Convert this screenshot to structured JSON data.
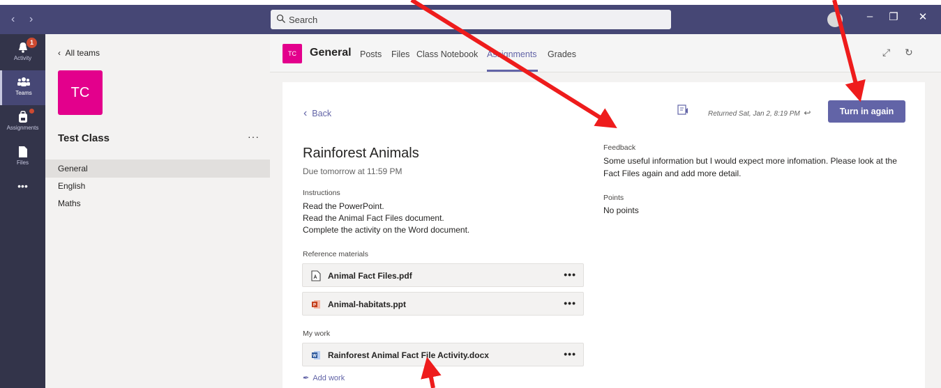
{
  "titlebar": {
    "back_icon": "chevron-left-icon",
    "forward_icon": "chevron-right-icon",
    "search_placeholder": "Search",
    "window_minimize": "–",
    "window_restore": "❐",
    "window_close": "✕"
  },
  "rail": {
    "items": [
      {
        "label": "Activity",
        "icon": "bell-icon",
        "badge": "1"
      },
      {
        "label": "Teams",
        "icon": "teams-icon"
      },
      {
        "label": "Assignments",
        "icon": "backpack-icon"
      },
      {
        "label": "Files",
        "icon": "file-icon"
      },
      {
        "label": "•••",
        "icon": "more-icon"
      }
    ]
  },
  "team_pane": {
    "back_label": "All teams",
    "tile_text": "TC",
    "team_name": "Test Class",
    "more": "···",
    "channels": [
      "General",
      "English",
      "Maths"
    ]
  },
  "channel_header": {
    "tile_text": "TC",
    "name": "General",
    "tabs": [
      "Posts",
      "Files",
      "Class Notebook",
      "Assignments",
      "Grades"
    ],
    "active_tab": "Assignments"
  },
  "assignment": {
    "back_label": "Back",
    "title": "Rainforest Animals",
    "due": "Due tomorrow at 11:59 PM",
    "instructions_label": "Instructions",
    "instructions": [
      "Read the PowerPoint.",
      "Read the Animal Fact Files document.",
      "Complete the activity on the Word document."
    ],
    "reference_label": "Reference materials",
    "reference_files": [
      {
        "name": "Animal Fact Files.pdf",
        "icon": "pdf-icon"
      },
      {
        "name": "Animal-habitats.ppt",
        "icon": "powerpoint-icon"
      }
    ],
    "my_work_label": "My work",
    "my_work_files": [
      {
        "name": "Rainforest Animal Fact File Activity.docx",
        "icon": "word-icon"
      }
    ],
    "add_work_label": "Add work",
    "file_more": "•••"
  },
  "status": {
    "returned": "Returned Sat, Jan 2, 8:19 PM",
    "turn_in_label": "Turn in again"
  },
  "feedback": {
    "label": "Feedback",
    "text": "Some useful information but I would expect more infomation.  Please look at the Fact Files again and add more detail.",
    "points_label": "Points",
    "points_value": "No points"
  },
  "colors": {
    "titlebar": "#464775",
    "rail": "#33344a",
    "accent": "#6264a7",
    "team_tile": "#e3008c",
    "annotation_arrow": "#ee1c1c"
  }
}
